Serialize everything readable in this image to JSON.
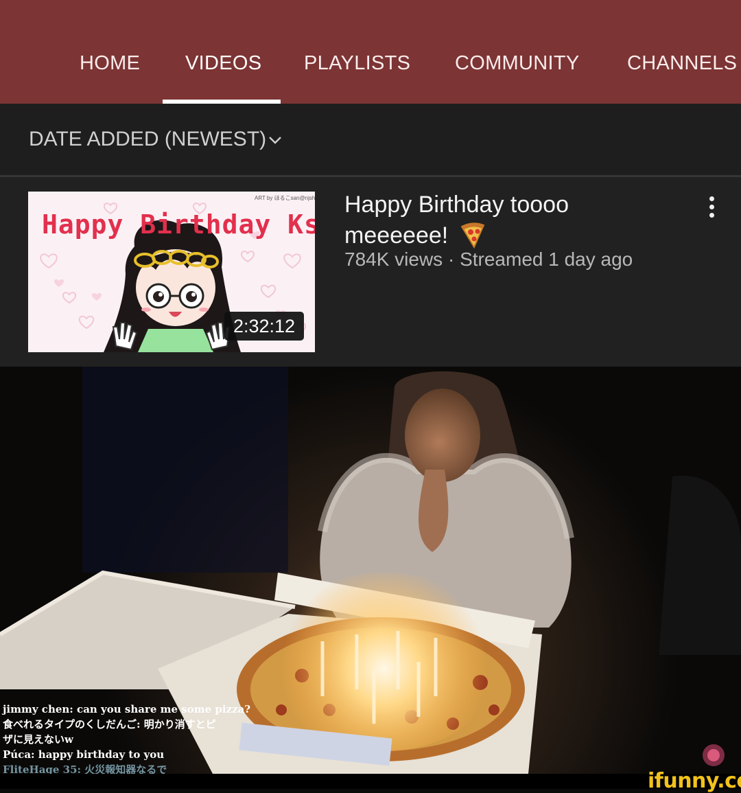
{
  "tabs": [
    {
      "label": "HOME",
      "active": false
    },
    {
      "label": "VIDEOS",
      "active": true
    },
    {
      "label": "PLAYLISTS",
      "active": false
    },
    {
      "label": "COMMUNITY",
      "active": false
    },
    {
      "label": "CHANNELS",
      "active": false
    }
  ],
  "sort": {
    "label": "DATE ADDED (NEWEST)",
    "icon": "chevron-down-icon"
  },
  "video": {
    "title": "Happy Birthday toooo meeeeee!",
    "title_emoji": "pizza-icon",
    "meta": "784K views · Streamed 1 day ago",
    "duration": "2:32:12",
    "thumbnail_text": "Happy Birthday Kson!",
    "thumbnail_credit": "ART by ほるこsan@njshrk"
  },
  "chat": [
    {
      "text": "jimmy chen: can you share me some pizza?"
    },
    {
      "text": "食べれるタイプのくしだんご: 明かり消すとピ"
    },
    {
      "text": "ザに見えないw"
    },
    {
      "text": "Púca: happy birthday to you"
    },
    {
      "text": "FliteHage 35: 火災報知器なるで"
    }
  ],
  "watermark": "ifunny.co",
  "colors": {
    "header_bg": "#7c3434",
    "sort_bg": "#1e1e1e",
    "row_bg": "#212121",
    "watermark": "#f2c21c",
    "thumb_title": "#e2304d"
  }
}
